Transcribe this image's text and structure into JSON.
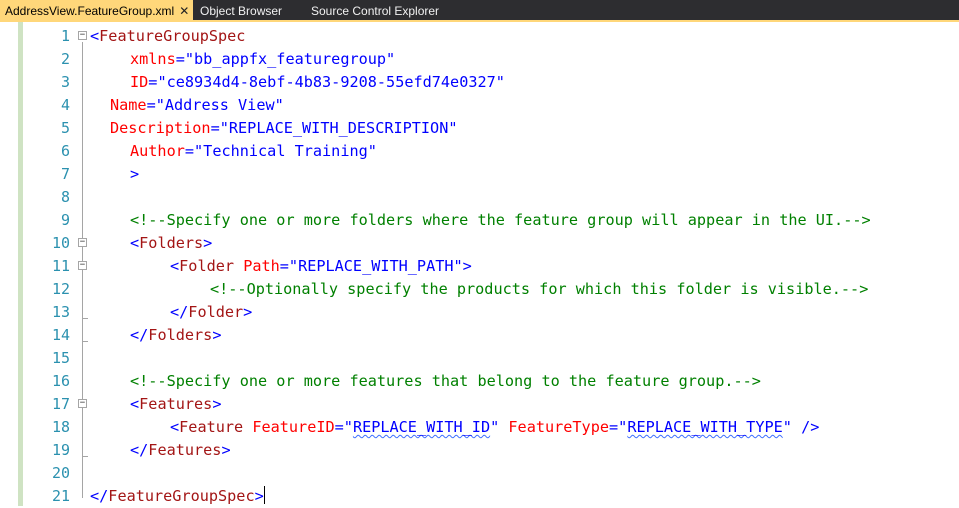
{
  "tabs": [
    {
      "label": "AddressView.FeatureGroup.xml",
      "close": "✕",
      "active": true
    },
    {
      "label": "Object Browser",
      "active": false
    },
    {
      "label": "Source Control Explorer",
      "active": false
    }
  ],
  "editor": {
    "line_numbers": [
      "1",
      "2",
      "3",
      "4",
      "5",
      "6",
      "7",
      "8",
      "9",
      "10",
      "11",
      "12",
      "13",
      "14",
      "15",
      "16",
      "17",
      "18",
      "19",
      "20",
      "21"
    ],
    "colors": {
      "tag": "#a31515",
      "bracket": "#0000ff",
      "attribute": "#ff0000",
      "value": "#0000ff",
      "comment": "#008000",
      "line_number": "#2b91af",
      "tab_active": "#ffd77a",
      "tab_strip": "#2d2d30"
    },
    "lines": {
      "l1": {
        "br_open": "<",
        "tag": "FeatureGroupSpec"
      },
      "l2": {
        "attr": "xmlns",
        "eq": "=",
        "val": "\"bb_appfx_featuregroup\""
      },
      "l3": {
        "attr": "ID",
        "eq": "=",
        "val": "\"ce8934d4-8ebf-4b83-9208-55efd74e0327\""
      },
      "l4": {
        "attr": "Name",
        "eq": "=",
        "val": "\"Address View\""
      },
      "l5": {
        "attr": "Description",
        "eq": "=",
        "val": "\"REPLACE_WITH_DESCRIPTION\""
      },
      "l6": {
        "attr": "Author",
        "eq": "=",
        "val": "\"Technical Training\""
      },
      "l7": {
        "br": ">"
      },
      "l9": {
        "comment": "<!--Specify one or more folders where the feature group will appear in the UI.-->"
      },
      "l10": {
        "br_open": "<",
        "tag": "Folders",
        "br_close": ">"
      },
      "l11": {
        "br_open": "<",
        "tag": "Folder",
        "attr": "Path",
        "eq": "=",
        "val": "\"REPLACE_WITH_PATH\"",
        "br_close": ">"
      },
      "l12": {
        "comment": "<!--Optionally specify the products for which this folder is visible.-->"
      },
      "l13": {
        "br_open": "</",
        "tag": "Folder",
        "br_close": ">"
      },
      "l14": {
        "br_open": "</",
        "tag": "Folders",
        "br_close": ">"
      },
      "l16": {
        "comment": "<!--Specify one or more features that belong to the feature group.-->"
      },
      "l17": {
        "br_open": "<",
        "tag": "Features",
        "br_close": ">"
      },
      "l18": {
        "br_open": "<",
        "tag": "Feature",
        "attr1": "FeatureID",
        "eq1": "=",
        "q1a": "\"",
        "val1": "REPLACE_WITH_ID",
        "q1b": "\"",
        "attr2": "FeatureType",
        "eq2": "=",
        "q2a": "\"",
        "val2": "REPLACE_WITH_TYPE",
        "q2b": "\"",
        "br_close": "/>"
      },
      "l19": {
        "br_open": "</",
        "tag": "Features",
        "br_close": ">"
      },
      "l21": {
        "br_open": "</",
        "tag": "FeatureGroupSpec",
        "br_close": ">"
      }
    }
  }
}
